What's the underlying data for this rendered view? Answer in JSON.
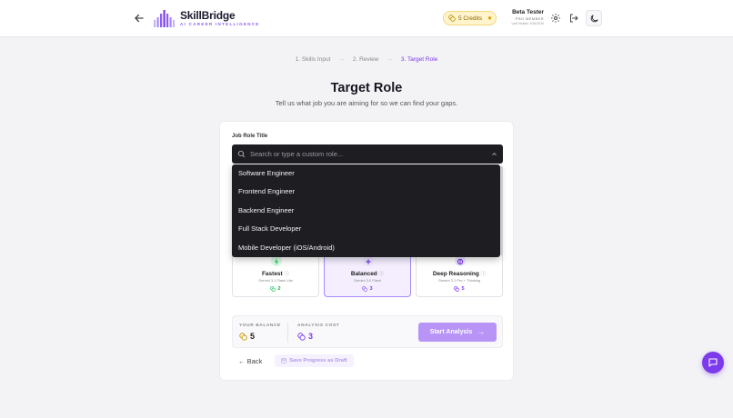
{
  "header": {
    "brand_name": "SkillBridge",
    "brand_tagline": "AI CAREER INTELLIGENCE",
    "credits_label": "5 Credits",
    "user_name": "Beta Tester",
    "user_tier": "PRO MEMBER",
    "last_visited": "Last Visited: 3/26/2026"
  },
  "stepper": {
    "steps": [
      "1. Skills Input",
      "2. Review",
      "3. Target Role"
    ],
    "separator": "→"
  },
  "page": {
    "title": "Target Role",
    "subtitle": "Tell us what job you are aiming for so we can find your gaps."
  },
  "role_field": {
    "label": "Job Role Title",
    "placeholder": "Search or type a custom role..."
  },
  "dropdown": {
    "options": [
      "Software Engineer",
      "Frontend Engineer",
      "Backend Engineer",
      "Full Stack Developer",
      "Mobile Developer (iOS/Android)"
    ]
  },
  "models": [
    {
      "name": "Fastest",
      "sub": "Gemini 3.1 Flash Lite",
      "cost": "2",
      "color": "#22c55e",
      "selected": false
    },
    {
      "name": "Balanced",
      "sub": "Gemini 3.0 Flash",
      "cost": "3",
      "color": "#8b5cf6",
      "selected": true
    },
    {
      "name": "Deep Reasoning",
      "sub": "Gemini 3.1 Pro + Thinking",
      "cost": "5",
      "color": "#7c3aed",
      "selected": false
    }
  ],
  "balance": {
    "balance_label": "YOUR BALANCE",
    "balance_value": "5",
    "cost_label": "ANALYSIS COST",
    "cost_value": "3",
    "start_label": "Start Analysis"
  },
  "footer_actions": {
    "back_label": "← Back",
    "draft_label": "Save Progress as Draft"
  },
  "colors": {
    "accent": "#7c3aed",
    "accent_light": "#b794f6",
    "credits_bg": "#fff4cc"
  }
}
